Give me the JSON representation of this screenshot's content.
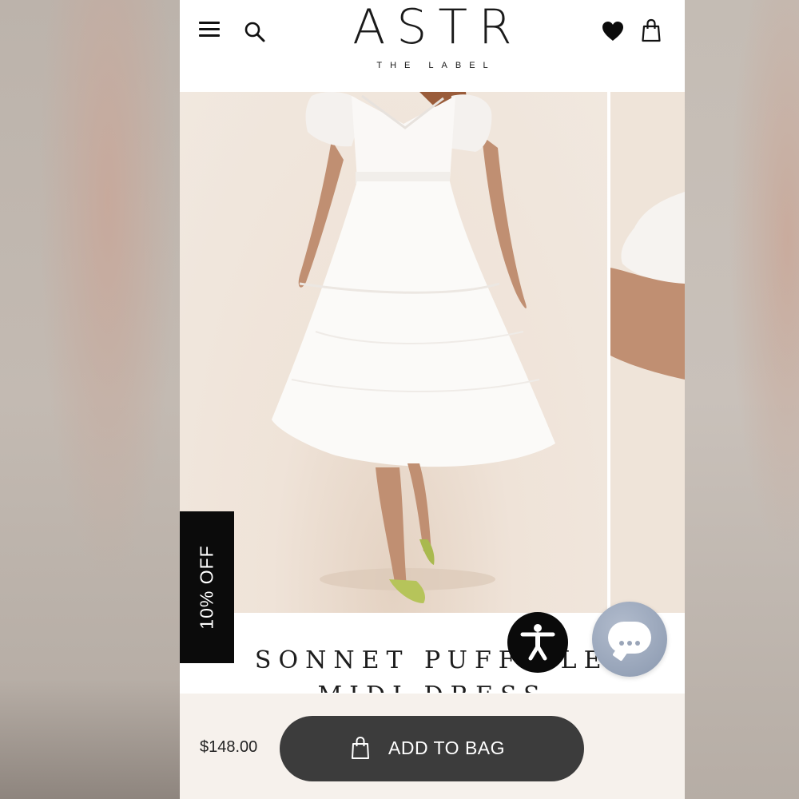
{
  "header": {
    "logo": "ASTR",
    "logo_sub": "THE LABEL"
  },
  "icons": {
    "menu": "menu-icon",
    "search": "search-icon",
    "wishlist": "heart-icon",
    "cart": "bag-icon",
    "accessibility": "accessibility-icon",
    "chat": "chat-icon"
  },
  "badge": {
    "label": "10% OFF"
  },
  "product": {
    "title_line1": "SONNET PUFF SLEEV",
    "title_line2": "MIDI DRESS",
    "price": "$148.00"
  },
  "cta": {
    "add_to_bag": "ADD TO BAG"
  },
  "colors": {
    "button": "#3c3c3c",
    "badge": "#0b0b0b",
    "chat": "#96a3b8",
    "background": "#f6f1ec"
  }
}
